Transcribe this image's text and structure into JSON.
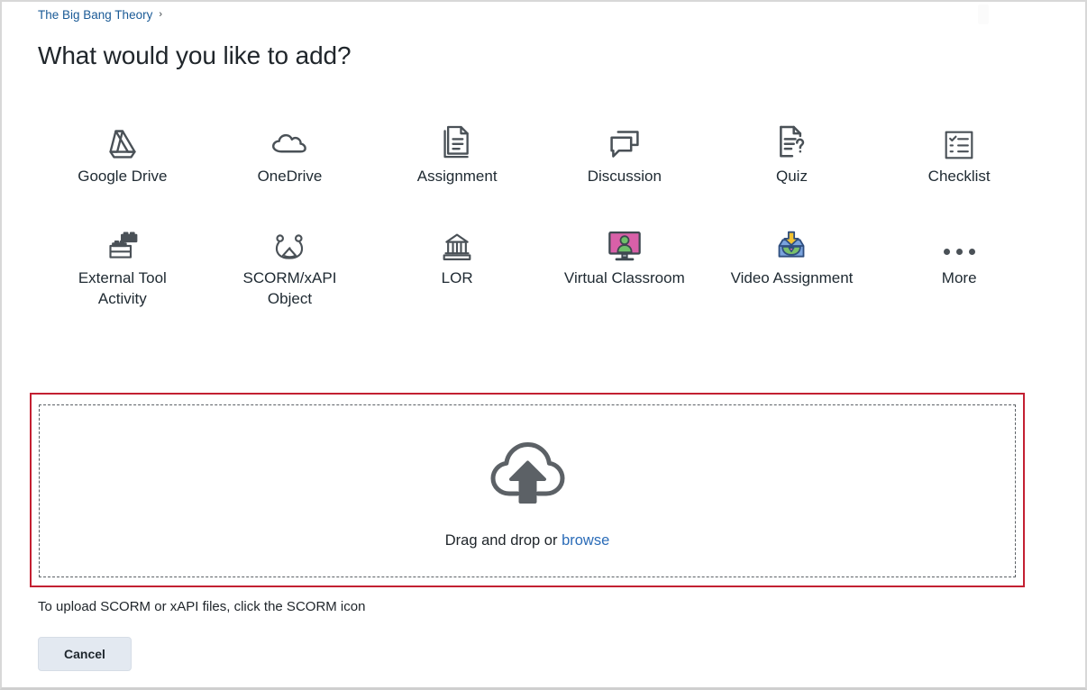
{
  "breadcrumb": {
    "label": "The Big Bang Theory",
    "separator": "›"
  },
  "header": {
    "title": "What would you like to add?"
  },
  "tools": [
    {
      "label": "Google Drive",
      "icon": "google-drive-icon"
    },
    {
      "label": "OneDrive",
      "icon": "onedrive-cloud-icon"
    },
    {
      "label": "Assignment",
      "icon": "assignment-document-icon"
    },
    {
      "label": "Discussion",
      "icon": "discussion-speech-bubbles-icon"
    },
    {
      "label": "Quiz",
      "icon": "quiz-question-document-icon"
    },
    {
      "label": "Checklist",
      "icon": "checklist-icon"
    },
    {
      "label": "External Tool Activity",
      "icon": "external-tool-lego-icon"
    },
    {
      "label": "SCORM/xAPI Object",
      "icon": "scorm-xapi-icon"
    },
    {
      "label": "LOR",
      "icon": "lor-building-icon"
    },
    {
      "label": "Virtual Classroom",
      "icon": "virtual-classroom-monitor-icon"
    },
    {
      "label": "Video Assignment",
      "icon": "video-assignment-tray-icon"
    },
    {
      "label": "More",
      "icon": "more-ellipsis-icon"
    }
  ],
  "dropzone": {
    "icon": "cloud-upload-icon",
    "text_prefix": "Drag and drop or ",
    "browse_label": "browse"
  },
  "footer": {
    "hint": "To upload SCORM or xAPI files, click the SCORM icon",
    "cancel_label": "Cancel"
  },
  "colors": {
    "link": "#2b6cb8",
    "breadcrumb_link": "#1a5a96",
    "highlight_border": "#c32032",
    "icon_dark": "#4a5157",
    "virtual_classroom_screen": "#d860a8",
    "virtual_classroom_person": "#6fc06a",
    "video_tray": "#7aa3dd",
    "video_arrow": "#f2c231",
    "video_object": "#79c06a",
    "video_play": "#e46ba8",
    "cancel_bg": "#e3e9f1"
  }
}
